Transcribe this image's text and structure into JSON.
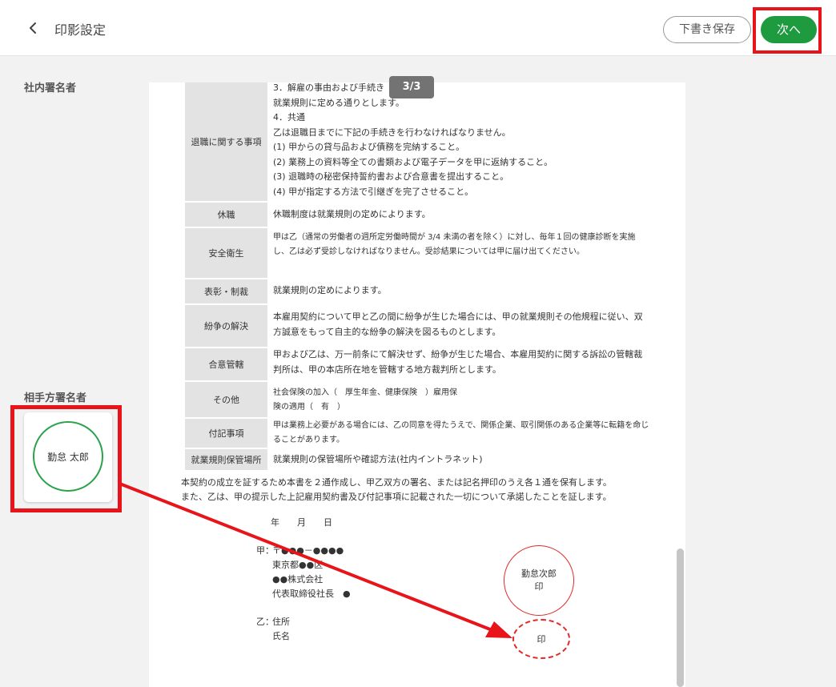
{
  "header": {
    "back_icon": "chevron-left-icon",
    "title": "印影設定",
    "draft_label": "下書き保存",
    "next_label": "次へ"
  },
  "sidebar": {
    "internal_signer_label": "社内署名者",
    "counterparty_signer_label": "相手方署名者",
    "stamp_name": "勤怠 太郎"
  },
  "document": {
    "page_indicator": "3/3",
    "retirement": {
      "label": "退職に関する事項",
      "lines": [
        "3．解雇の事由および手続き",
        "就業規則に定める通りとします。",
        "4．共通",
        "乙は退職日までに下記の手続きを行わなければなりません。",
        "(1) 甲からの貸与品および債務を完納すること。",
        "(2) 業務上の資料等全ての書類および電子データを甲に返納すること。",
        "(3) 退職時の秘密保持誓約書および合意書を提出すること。",
        "(4) 甲が指定する方法で引継ぎを完了させること。"
      ]
    },
    "rows": [
      {
        "label": "休職",
        "value": "休職制度は就業規則の定めによります。"
      },
      {
        "label": "安全衛生",
        "value": "甲は乙（通常の労働者の週所定労働時間が 3/4 未満の者を除く）に対し、毎年１回の健康診断を実施し、乙は必ず受診しなければなりません。受診結果については甲に届け出てください。"
      },
      {
        "label": "表彰・制裁",
        "value": "就業規則の定めによります。"
      },
      {
        "label": "紛争の解決",
        "value": "本雇用契約について甲と乙の間に紛争が生じた場合には、甲の就業規則その他規程に従い、双方誠意をもって自主的な紛争の解決を図るものとします。"
      },
      {
        "label": "合意管轄",
        "value": "甲および乙は、万一前条にて解決せず、紛争が生じた場合、本雇用契約に関する訴訟の管轄裁判所は、甲の本店所在地を管轄する地方裁判所とします。"
      },
      {
        "label": "その他",
        "value": "社会保険の加入（　厚生年金、健康保険　）雇用保険の適用（　有　）"
      },
      {
        "label": "付記事項",
        "value": "甲は業務上必要がある場合には、乙の同意を得たうえで、関係企業、取引関係のある企業等に転籍を命じることがあります。"
      },
      {
        "label": "就業規則保管場所",
        "value": "就業規則の保管場所や確認方法(社内イントラネット)"
      }
    ],
    "closing_1": "本契約の成立を証するため本書を２通作成し、甲乙双方の署名、または記名押印のうえ各１通を保有します。",
    "closing_2": "また、乙は、甲の提示した上記雇用契約書及び付記事項に記載された一切について承諾したことを証します。",
    "date_line": "年　　月　　日",
    "party_a": {
      "label": "甲：",
      "postal": "〒●●●－●●●●",
      "address": "東京都●●区",
      "company": "●●株式会社",
      "representative": "代表取締役社長　●"
    },
    "party_b": {
      "label": "乙：",
      "address": "住所",
      "name": "氏名"
    },
    "red_seal": {
      "name": "勤怠次郎",
      "mark": "印"
    },
    "drop_target": {
      "mark": "印"
    }
  },
  "colors": {
    "accent": "#1e9a3f",
    "highlight": "#e8141a",
    "stamp_green": "#2aa24a",
    "seal_red": "#e02a2a"
  }
}
